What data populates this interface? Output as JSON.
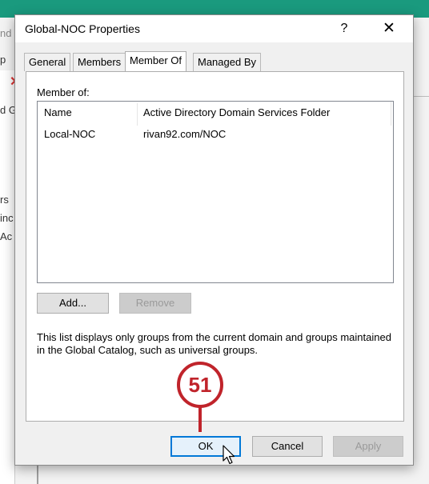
{
  "background": {
    "fragments": [
      "nd",
      "p",
      "d G",
      "rs",
      "inc",
      "Ac"
    ]
  },
  "dialog": {
    "title": "Global-NOC Properties",
    "help_label": "?",
    "close_label": "✕",
    "tabs": [
      "General",
      "Members",
      "Member Of",
      "Managed By"
    ],
    "active_tab": "Member Of",
    "member_of_label": "Member of:",
    "list": {
      "columns": [
        "Name",
        "Active Directory Domain Services Folder"
      ],
      "rows": [
        {
          "name": "Local-NOC",
          "folder": "rivan92.com/NOC"
        }
      ]
    },
    "add_label": "Add...",
    "remove_label": "Remove",
    "info_text": "This list displays only groups from the current domain and groups maintained in the Global Catalog, such as universal groups.",
    "ok_label": "OK",
    "cancel_label": "Cancel",
    "apply_label": "Apply"
  },
  "callout": {
    "step": "51"
  },
  "colors": {
    "accent": "#0078d7",
    "callout": "#c0242b",
    "title_bar_bg": "#1a9a7e"
  }
}
